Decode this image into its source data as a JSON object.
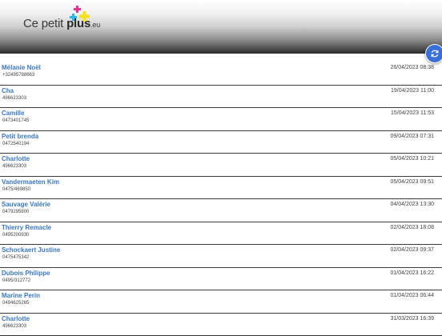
{
  "header": {
    "logo": {
      "text_main": "Ce petit ",
      "text_bold": "plus",
      "text_suffix": ".eu"
    }
  },
  "colors": {
    "accent": "#3b6fd8",
    "name_link": "#3a78c8",
    "logo_cyan": "#2fb6e8",
    "logo_magenta": "#e8318c",
    "logo_yellow": "#f4e21b"
  },
  "contacts": [
    {
      "name": "Mélanie Noël",
      "phone": "+32495788663",
      "date": "26/04/2023 08:38"
    },
    {
      "name": "Cha",
      "phone": "496623303",
      "date": "19/04/2023 11:00"
    },
    {
      "name": "Camille",
      "phone": "0473401745",
      "date": "15/04/2023 11:53"
    },
    {
      "name": "Petit brenda",
      "phone": "0472540194",
      "date": "09/04/2023 07:31"
    },
    {
      "name": "Charlotte",
      "phone": "496623303",
      "date": "05/04/2023 10:21"
    },
    {
      "name": "Vandermaeten Kim",
      "phone": "0475/469850",
      "date": "05/04/2023 09:51"
    },
    {
      "name": "Sauvage Valérie",
      "phone": "0479295800",
      "date": "04/04/2023 13:30"
    },
    {
      "name": "Thierry Remacle",
      "phone": "0495200930",
      "date": "02/04/2023 18:08"
    },
    {
      "name": "Schockaert Justine",
      "phone": "0475475342",
      "date": "02/04/2023 09:37"
    },
    {
      "name": "Dubois Philippe",
      "phone": "0495/312772",
      "date": "01/04/2023 16:22"
    },
    {
      "name": "Marine Perin",
      "phone": "0494625265",
      "date": "01/04/2023 06:44"
    },
    {
      "name": "Charlotte",
      "phone": "496623303",
      "date": "31/03/2023 16:39"
    }
  ]
}
